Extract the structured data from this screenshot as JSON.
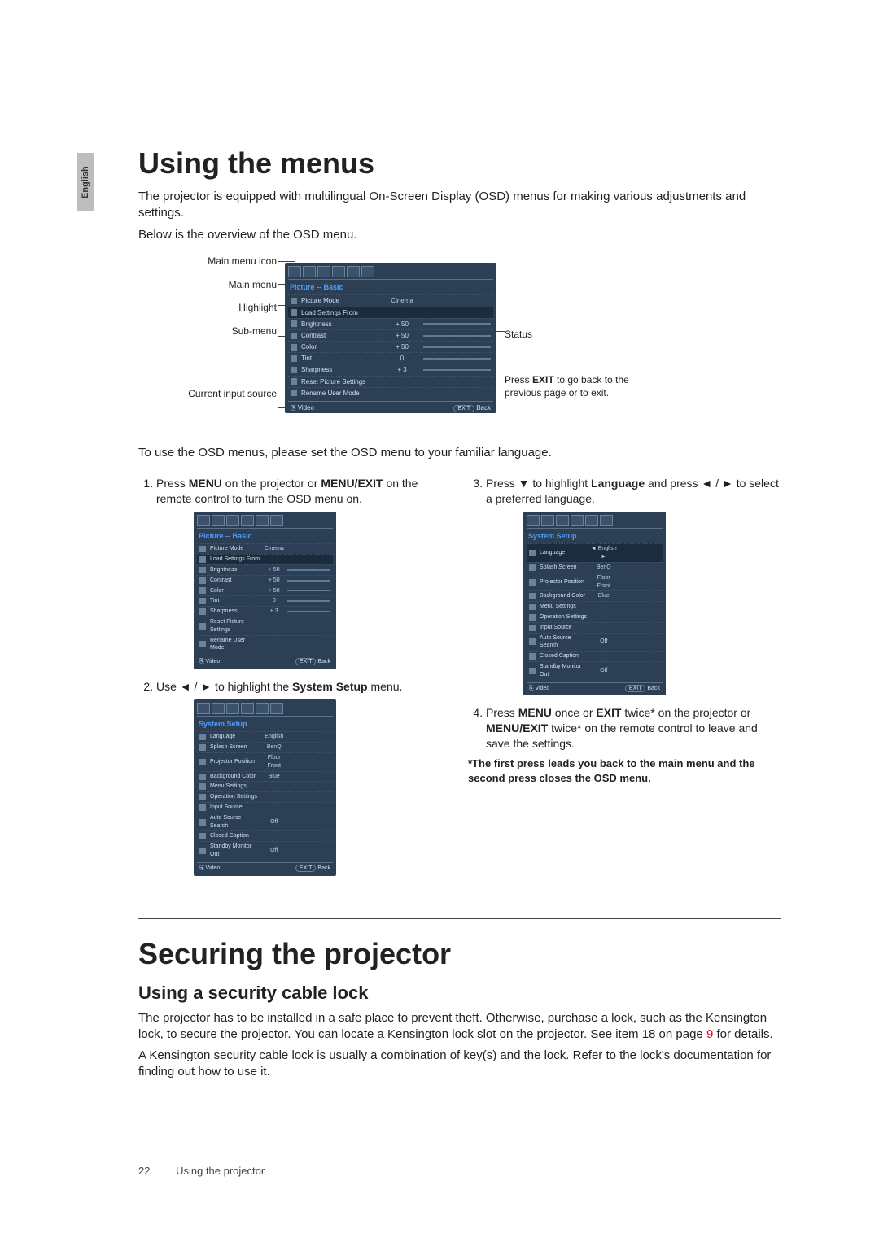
{
  "lang_tab": "English",
  "h1_menus": "Using the menus",
  "intro1": "The projector is equipped with multilingual On-Screen Display (OSD) menus for making various adjustments and settings.",
  "intro2": "Below is the overview of the OSD menu.",
  "ov_left": {
    "main_icon": "Main menu icon",
    "main_menu": "Main menu",
    "highlight": "Highlight",
    "sub_menu": "Sub-menu",
    "current_input": "Current input source"
  },
  "ov_right": {
    "status": "Status",
    "exit_note_1": "Press ",
    "exit_note_bold": "EXIT",
    "exit_note_2": " to go back to the previous page or to exit."
  },
  "after_overview": "To use the OSD menus, please set the OSD menu to your familiar language.",
  "step1_a": "Press ",
  "step1_b1": "MENU",
  "step1_c": " on the projector or ",
  "step1_b2": "MENU/EXIT",
  "step1_d": " on the remote control to turn the OSD menu on.",
  "step2_a": "Use ◄ / ► to highlight the ",
  "step2_b": "System Setup",
  "step2_c": " menu.",
  "step3_a": "Press ▼ to highlight ",
  "step3_b": "Language",
  "step3_c": " and press ◄ / ► to select a preferred language.",
  "step4_a": "Press ",
  "step4_b1": "MENU",
  "step4_c": " once or ",
  "step4_b2": "EXIT",
  "step4_d": " twice* on the projector or ",
  "step4_b3": "MENU/EXIT",
  "step4_e": " twice* on the remote control to leave and save the settings.",
  "star_note": "*The first press leads you back to the main menu and the second press closes the OSD menu.",
  "h1_secure": "Securing the projector",
  "h2_lock": "Using a security cable lock",
  "sec_p1_a": "The projector has to be installed in a safe place to prevent theft. Otherwise, purchase a lock, such as the Kensington lock, to secure the projector. You can locate a Kensington lock slot on the projector. See item 18 on page ",
  "sec_p1_pg": "9",
  "sec_p1_b": " for details.",
  "sec_p2": "A Kensington security cable lock is usually a combination of key(s) and the lock. Refer to the lock's documentation for finding out how to use it.",
  "footer_page": "22",
  "footer_section": "Using the projector",
  "osd_big": {
    "title": "Picture -- Basic",
    "rows": [
      {
        "key": "Picture Mode",
        "val": "Cinema",
        "bar": false
      },
      {
        "key": "Load Settings From",
        "val": "",
        "bar": false,
        "hl": true
      },
      {
        "key": "Brightness",
        "val": "+ 50",
        "bar": true
      },
      {
        "key": "Contrast",
        "val": "+ 50",
        "bar": true
      },
      {
        "key": "Color",
        "val": "+ 50",
        "bar": true
      },
      {
        "key": "Tint",
        "val": "0",
        "bar": true
      },
      {
        "key": "Sharpness",
        "val": "+ 3",
        "bar": true
      },
      {
        "key": "Reset Picture Settings",
        "val": "",
        "bar": false
      },
      {
        "key": "Rename User Mode",
        "val": "",
        "bar": false
      }
    ],
    "foot_src": "Video",
    "foot_exit": "EXIT",
    "foot_back": "Back"
  },
  "osd_step1": {
    "title": "Picture -- Basic",
    "rows": [
      {
        "key": "Picture Mode",
        "val": "Cinema",
        "bar": false
      },
      {
        "key": "Load Settings From",
        "val": "",
        "bar": false,
        "hl": true
      },
      {
        "key": "Brightness",
        "val": "+ 50",
        "bar": true
      },
      {
        "key": "Contrast",
        "val": "+ 50",
        "bar": true
      },
      {
        "key": "Color",
        "val": "+ 50",
        "bar": true
      },
      {
        "key": "Tint",
        "val": "0",
        "bar": true
      },
      {
        "key": "Sharpness",
        "val": "+ 3",
        "bar": true
      },
      {
        "key": "Reset Picture Settings",
        "val": "",
        "bar": false
      },
      {
        "key": "Rename User Mode",
        "val": "",
        "bar": false
      }
    ],
    "foot_src": "Video",
    "foot_exit": "EXIT",
    "foot_back": "Back"
  },
  "osd_step2": {
    "title": "System Setup",
    "rows": [
      {
        "key": "Language",
        "val": "English",
        "bar": false
      },
      {
        "key": "Splash Screen",
        "val": "BenQ",
        "bar": false
      },
      {
        "key": "Projector Position",
        "val": "Floor Front",
        "bar": false
      },
      {
        "key": "Background Color",
        "val": "Blue",
        "bar": false
      },
      {
        "key": "Menu Settings",
        "val": "",
        "bar": false
      },
      {
        "key": "Operation Settings",
        "val": "",
        "bar": false
      },
      {
        "key": "Input Source",
        "val": "",
        "bar": false
      },
      {
        "key": "Auto Source Search",
        "val": "Off",
        "bar": false
      },
      {
        "key": "Closed Caption",
        "val": "",
        "bar": false
      },
      {
        "key": "Standby Monitor Out",
        "val": "Off",
        "bar": false
      }
    ],
    "foot_src": "Video",
    "foot_exit": "EXIT",
    "foot_back": "Back"
  },
  "osd_step3": {
    "title": "System Setup",
    "rows": [
      {
        "key": "Language",
        "val": "English",
        "bar": false,
        "hl": true,
        "arrows": true
      },
      {
        "key": "Splash Screen",
        "val": "BenQ",
        "bar": false
      },
      {
        "key": "Projector Position",
        "val": "Floor Front",
        "bar": false
      },
      {
        "key": "Background Color",
        "val": "Blue",
        "bar": false
      },
      {
        "key": "Menu Settings",
        "val": "",
        "bar": false
      },
      {
        "key": "Operation Settings",
        "val": "",
        "bar": false
      },
      {
        "key": "Input Source",
        "val": "",
        "bar": false
      },
      {
        "key": "Auto Source Search",
        "val": "Off",
        "bar": false
      },
      {
        "key": "Closed Caption",
        "val": "",
        "bar": false
      },
      {
        "key": "Standby Monitor Out",
        "val": "Off",
        "bar": false
      }
    ],
    "foot_src": "Video",
    "foot_exit": "EXIT",
    "foot_back": "Back"
  }
}
